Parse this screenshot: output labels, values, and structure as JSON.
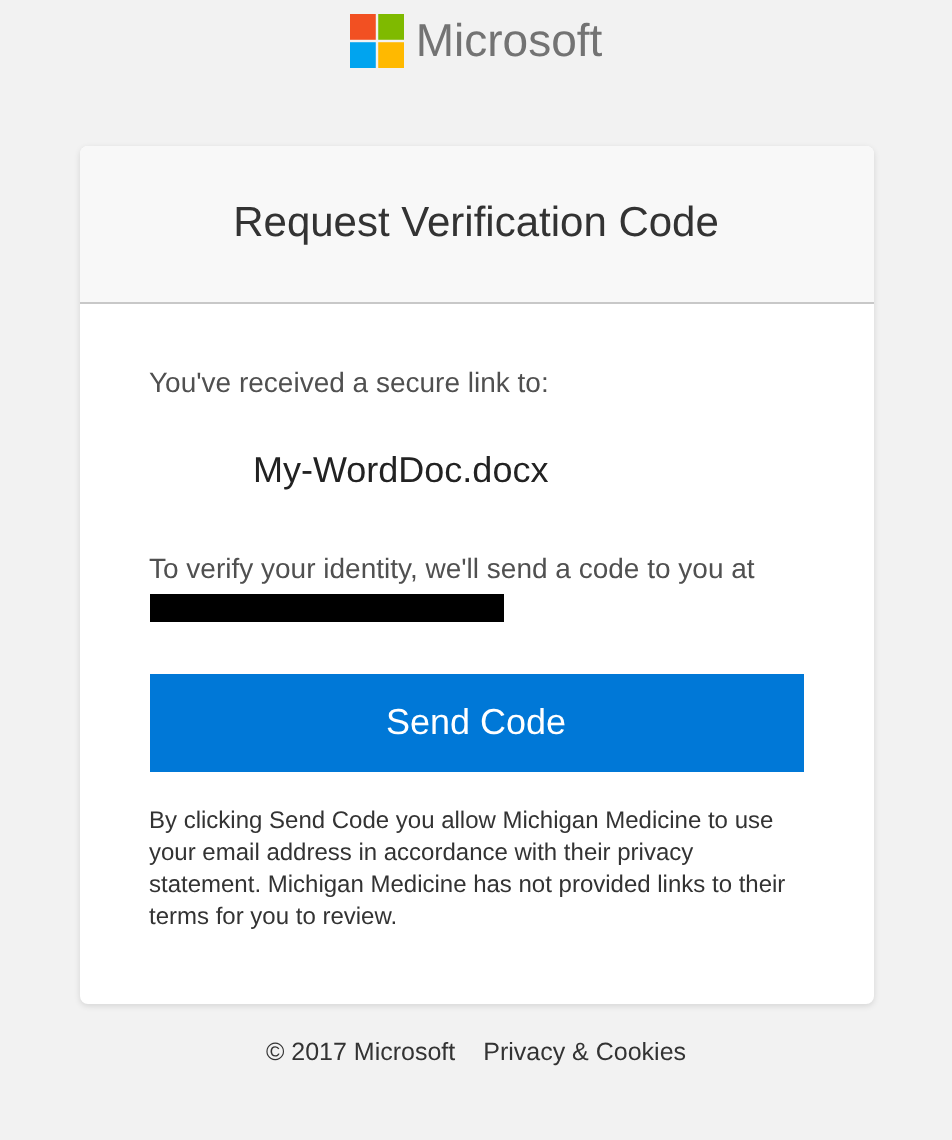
{
  "logo": {
    "text": "Microsoft"
  },
  "card": {
    "title": "Request Verification Code",
    "intro": "You've received a secure link to:",
    "file_name": "My-WordDoc.docx",
    "verify_text": "To verify your identity, we'll send a code to you at",
    "recipient": {
      "redacted": true
    },
    "button": "Send Code",
    "disclaimer": "By clicking Send Code you allow Michigan Medicine to use your email address in accordance with their privacy statement. Michigan Medicine has not provided links to their terms for you to review."
  },
  "footer": {
    "copyright": "© 2017 Microsoft",
    "links": [
      "Privacy & Cookies"
    ]
  }
}
